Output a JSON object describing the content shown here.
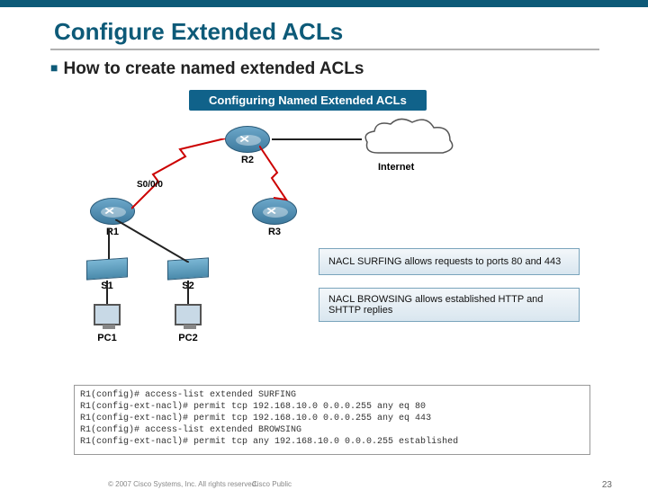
{
  "title": "Configure Extended ACLs",
  "bullet": "How to create named extended ACLs",
  "panel_title": "Configuring Named Extended ACLs",
  "devices": {
    "r1": "R1",
    "r2": "R2",
    "r3": "R3",
    "s1": "S1",
    "s2": "S2",
    "pc1": "PC1",
    "pc2": "PC2",
    "internet": "Internet"
  },
  "interfaces": {
    "s000": "S0/0/0"
  },
  "notes": {
    "surfing": "NACL SURFING allows requests to ports 80 and 443",
    "browsing": "NACL BROWSING allows established HTTP and SHTTP replies"
  },
  "cli": [
    "R1(config)# access-list extended SURFING",
    "R1(config-ext-nacl)# permit tcp 192.168.10.0 0.0.0.255 any eq 80",
    "R1(config-ext-nacl)# permit tcp 192.168.10.0 0.0.0.255 any eq 443",
    "R1(config)# access-list extended BROWSING",
    "R1(config-ext-nacl)# permit tcp any 192.168.10.0 0.0.0.255 established"
  ],
  "footer": {
    "copyright": "© 2007 Cisco Systems, Inc. All rights reserved.",
    "classification": "Cisco Public",
    "page": "23"
  }
}
